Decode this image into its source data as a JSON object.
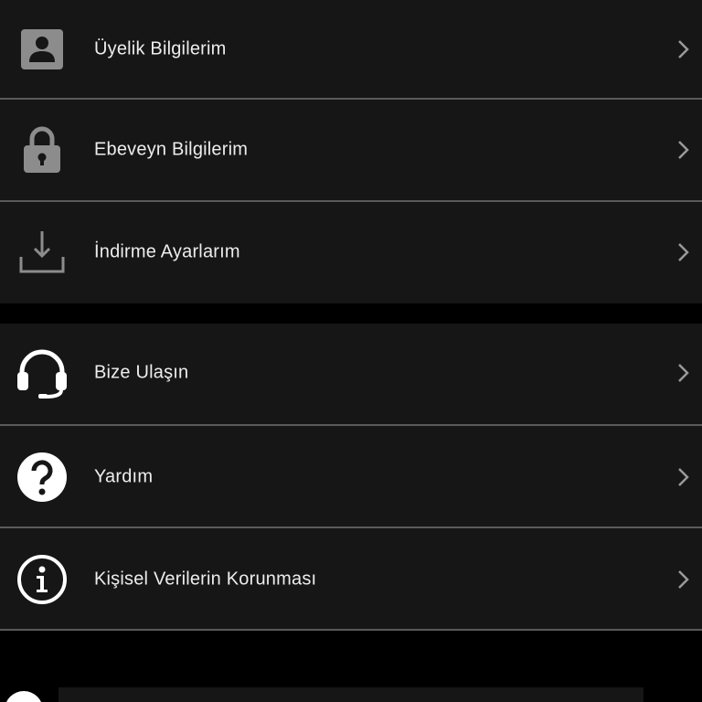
{
  "menu_groups": [
    {
      "items": [
        {
          "label": "Üyelik Bilgilerim",
          "icon": "account-box-icon"
        },
        {
          "label": "Ebeveyn Bilgilerim",
          "icon": "lock-icon"
        },
        {
          "label": "İndirme Ayarlarım",
          "icon": "download-icon"
        }
      ]
    },
    {
      "items": [
        {
          "label": "Bize Ulaşın",
          "icon": "headset-icon"
        },
        {
          "label": "Yardım",
          "icon": "help-circle-icon"
        },
        {
          "label": "Kişisel Verilerin Korunması",
          "icon": "info-circle-icon"
        }
      ]
    }
  ],
  "colors": {
    "background": "#000000",
    "row_background": "#161616",
    "divider": "#5a5a5a",
    "text": "#ededed",
    "icon_gray": "#8c8c8c",
    "icon_white": "#ffffff",
    "chevron": "#9a9a9a"
  }
}
